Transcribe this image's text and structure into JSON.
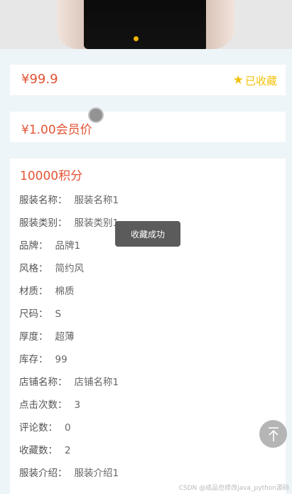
{
  "price": "¥99.9",
  "favorite_label": "已收藏",
  "member_price": "¥1.00会员价",
  "points": "10000积分",
  "details": [
    {
      "key": "服装名称：",
      "value": "服装名称1"
    },
    {
      "key": "服装类别：",
      "value": "服装类别1"
    },
    {
      "key": "品牌：",
      "value": "品牌1"
    },
    {
      "key": "风格：",
      "value": "简约风"
    },
    {
      "key": "材质：",
      "value": "棉质"
    },
    {
      "key": "尺码：",
      "value": "S"
    },
    {
      "key": "厚度：",
      "value": "超薄"
    },
    {
      "key": "库存：",
      "value": "99"
    },
    {
      "key": "店铺名称：",
      "value": "店铺名称1"
    },
    {
      "key": "点击次数：",
      "value": "3"
    },
    {
      "key": "评论数：",
      "value": "0"
    },
    {
      "key": "收藏数：",
      "value": "2"
    },
    {
      "key": "服装介绍：",
      "value": "服装介绍1"
    }
  ],
  "toast": "收藏成功",
  "watermark": "CSDN @成品也修改java_python源码",
  "icons": {
    "favorite": "star-icon",
    "back_to_top": "arrow-up-icon"
  },
  "colors": {
    "price": "#e25434",
    "favorite": "#f2c20b",
    "background": "#edf5f8"
  }
}
